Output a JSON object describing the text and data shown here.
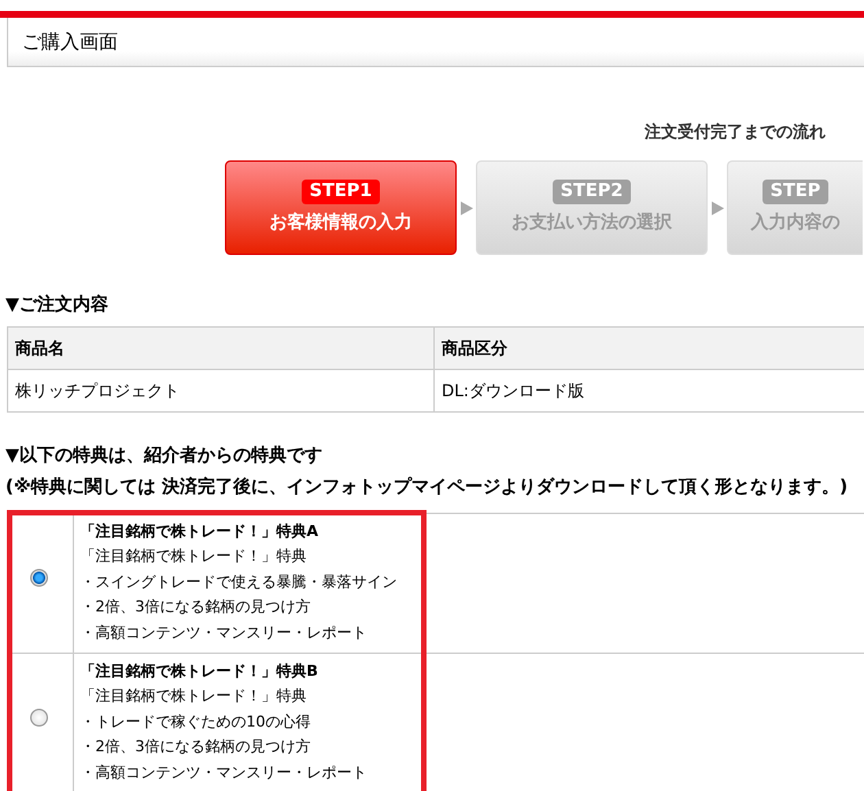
{
  "header": {
    "title": "ご購入画面"
  },
  "flow": {
    "title": "注文受付完了までの流れ",
    "steps": [
      {
        "badge": "STEP1",
        "label": "お客様情報の入力",
        "current": true
      },
      {
        "badge": "STEP2",
        "label": "お支払い方法の選択",
        "current": false
      },
      {
        "badge": "STEP",
        "label": "入力内容の",
        "current": false
      }
    ]
  },
  "order": {
    "heading": "▼ご注文内容",
    "columns": [
      "商品名",
      "商品区分"
    ],
    "rows": [
      [
        "株リッチプロジェクト",
        "DL:ダウンロード版"
      ]
    ]
  },
  "benefits": {
    "heading": "▼以下の特典は、紹介者からの特典です",
    "note": "(※特典に関しては 決済完了後に、インフォトップマイページよりダウンロードして頂く形となります。)",
    "items": [
      {
        "selected": true,
        "title": "「注目銘柄で株トレード！」特典A",
        "lines": [
          "「注目銘柄で株トレード！」特典",
          "・スイングトレードで使える暴騰・暴落サイン",
          "・2倍、3倍になる銘柄の見つけ方",
          "・高額コンテンツ・マンスリー・レポート"
        ]
      },
      {
        "selected": false,
        "title": "「注目銘柄で株トレード！」特典B",
        "lines": [
          "「注目銘柄で株トレード！」特典",
          "・トレードで稼ぐための10の心得",
          "・2倍、3倍になる銘柄の見つけ方",
          "・高額コンテンツ・マンスリー・レポート"
        ]
      }
    ]
  }
}
